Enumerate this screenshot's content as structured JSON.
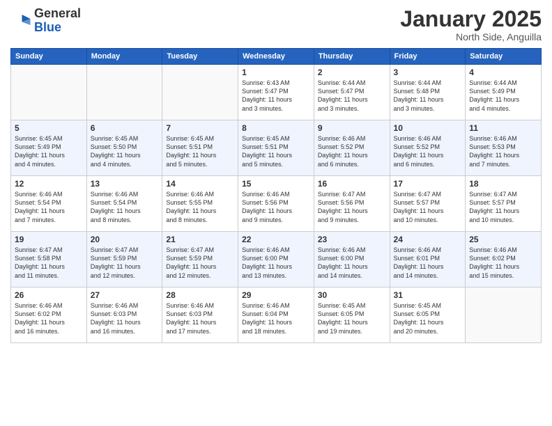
{
  "header": {
    "logo_general": "General",
    "logo_blue": "Blue",
    "month": "January 2025",
    "location": "North Side, Anguilla"
  },
  "weekdays": [
    "Sunday",
    "Monday",
    "Tuesday",
    "Wednesday",
    "Thursday",
    "Friday",
    "Saturday"
  ],
  "weeks": [
    [
      {
        "day": "",
        "info": ""
      },
      {
        "day": "",
        "info": ""
      },
      {
        "day": "",
        "info": ""
      },
      {
        "day": "1",
        "info": "Sunrise: 6:43 AM\nSunset: 5:47 PM\nDaylight: 11 hours\nand 3 minutes."
      },
      {
        "day": "2",
        "info": "Sunrise: 6:44 AM\nSunset: 5:47 PM\nDaylight: 11 hours\nand 3 minutes."
      },
      {
        "day": "3",
        "info": "Sunrise: 6:44 AM\nSunset: 5:48 PM\nDaylight: 11 hours\nand 3 minutes."
      },
      {
        "day": "4",
        "info": "Sunrise: 6:44 AM\nSunset: 5:49 PM\nDaylight: 11 hours\nand 4 minutes."
      }
    ],
    [
      {
        "day": "5",
        "info": "Sunrise: 6:45 AM\nSunset: 5:49 PM\nDaylight: 11 hours\nand 4 minutes."
      },
      {
        "day": "6",
        "info": "Sunrise: 6:45 AM\nSunset: 5:50 PM\nDaylight: 11 hours\nand 4 minutes."
      },
      {
        "day": "7",
        "info": "Sunrise: 6:45 AM\nSunset: 5:51 PM\nDaylight: 11 hours\nand 5 minutes."
      },
      {
        "day": "8",
        "info": "Sunrise: 6:45 AM\nSunset: 5:51 PM\nDaylight: 11 hours\nand 5 minutes."
      },
      {
        "day": "9",
        "info": "Sunrise: 6:46 AM\nSunset: 5:52 PM\nDaylight: 11 hours\nand 6 minutes."
      },
      {
        "day": "10",
        "info": "Sunrise: 6:46 AM\nSunset: 5:52 PM\nDaylight: 11 hours\nand 6 minutes."
      },
      {
        "day": "11",
        "info": "Sunrise: 6:46 AM\nSunset: 5:53 PM\nDaylight: 11 hours\nand 7 minutes."
      }
    ],
    [
      {
        "day": "12",
        "info": "Sunrise: 6:46 AM\nSunset: 5:54 PM\nDaylight: 11 hours\nand 7 minutes."
      },
      {
        "day": "13",
        "info": "Sunrise: 6:46 AM\nSunset: 5:54 PM\nDaylight: 11 hours\nand 8 minutes."
      },
      {
        "day": "14",
        "info": "Sunrise: 6:46 AM\nSunset: 5:55 PM\nDaylight: 11 hours\nand 8 minutes."
      },
      {
        "day": "15",
        "info": "Sunrise: 6:46 AM\nSunset: 5:56 PM\nDaylight: 11 hours\nand 9 minutes."
      },
      {
        "day": "16",
        "info": "Sunrise: 6:47 AM\nSunset: 5:56 PM\nDaylight: 11 hours\nand 9 minutes."
      },
      {
        "day": "17",
        "info": "Sunrise: 6:47 AM\nSunset: 5:57 PM\nDaylight: 11 hours\nand 10 minutes."
      },
      {
        "day": "18",
        "info": "Sunrise: 6:47 AM\nSunset: 5:57 PM\nDaylight: 11 hours\nand 10 minutes."
      }
    ],
    [
      {
        "day": "19",
        "info": "Sunrise: 6:47 AM\nSunset: 5:58 PM\nDaylight: 11 hours\nand 11 minutes."
      },
      {
        "day": "20",
        "info": "Sunrise: 6:47 AM\nSunset: 5:59 PM\nDaylight: 11 hours\nand 12 minutes."
      },
      {
        "day": "21",
        "info": "Sunrise: 6:47 AM\nSunset: 5:59 PM\nDaylight: 11 hours\nand 12 minutes."
      },
      {
        "day": "22",
        "info": "Sunrise: 6:46 AM\nSunset: 6:00 PM\nDaylight: 11 hours\nand 13 minutes."
      },
      {
        "day": "23",
        "info": "Sunrise: 6:46 AM\nSunset: 6:00 PM\nDaylight: 11 hours\nand 14 minutes."
      },
      {
        "day": "24",
        "info": "Sunrise: 6:46 AM\nSunset: 6:01 PM\nDaylight: 11 hours\nand 14 minutes."
      },
      {
        "day": "25",
        "info": "Sunrise: 6:46 AM\nSunset: 6:02 PM\nDaylight: 11 hours\nand 15 minutes."
      }
    ],
    [
      {
        "day": "26",
        "info": "Sunrise: 6:46 AM\nSunset: 6:02 PM\nDaylight: 11 hours\nand 16 minutes."
      },
      {
        "day": "27",
        "info": "Sunrise: 6:46 AM\nSunset: 6:03 PM\nDaylight: 11 hours\nand 16 minutes."
      },
      {
        "day": "28",
        "info": "Sunrise: 6:46 AM\nSunset: 6:03 PM\nDaylight: 11 hours\nand 17 minutes."
      },
      {
        "day": "29",
        "info": "Sunrise: 6:46 AM\nSunset: 6:04 PM\nDaylight: 11 hours\nand 18 minutes."
      },
      {
        "day": "30",
        "info": "Sunrise: 6:45 AM\nSunset: 6:05 PM\nDaylight: 11 hours\nand 19 minutes."
      },
      {
        "day": "31",
        "info": "Sunrise: 6:45 AM\nSunset: 6:05 PM\nDaylight: 11 hours\nand 20 minutes."
      },
      {
        "day": "",
        "info": ""
      }
    ]
  ]
}
